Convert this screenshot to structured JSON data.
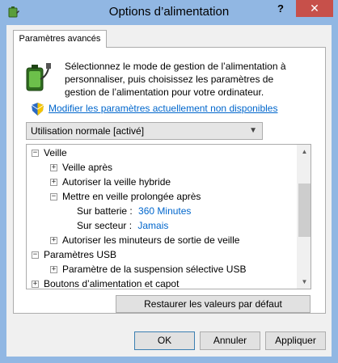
{
  "window": {
    "title": "Options d’alimentation",
    "help_label": "?",
    "close_label": "✕"
  },
  "tabs": [
    {
      "label": "Paramètres avancés"
    }
  ],
  "description": "Sélectionnez le mode de gestion de l’alimentation à personnaliser, puis choisissez les paramètres de gestion de l’alimentation pour votre ordinateur.",
  "modify_link": "Modifier les paramètres actuellement non disponibles",
  "plan_select": {
    "selected": "Utilisation normale [activé]"
  },
  "tree": {
    "items": [
      {
        "toggle": "−",
        "label": "Veille"
      },
      {
        "toggle": "+",
        "label": "Veille après"
      },
      {
        "toggle": "+",
        "label": "Autoriser la veille hybride"
      },
      {
        "toggle": "−",
        "label": "Mettre en veille prolongée après"
      },
      {
        "label": "Sur batterie :",
        "value": "360 Minutes"
      },
      {
        "label": "Sur secteur :",
        "value": "Jamais"
      },
      {
        "toggle": "+",
        "label": "Autoriser les minuteurs de sortie de veille"
      },
      {
        "toggle": "−",
        "label": "Paramètres USB"
      },
      {
        "toggle": "+",
        "label": "Paramètre de la suspension sélective USB"
      },
      {
        "toggle": "+",
        "label": "Boutons d’alimentation et capot"
      }
    ]
  },
  "buttons": {
    "restore": "Restaurer les valeurs par défaut",
    "ok": "OK",
    "cancel": "Annuler",
    "apply": "Appliquer"
  },
  "scrollbar": {
    "up_arrow": "▲",
    "down_arrow": "▼"
  },
  "colors": {
    "title_bar": "#91b7e3",
    "close_button": "#c7504a",
    "link": "#0066cc"
  }
}
